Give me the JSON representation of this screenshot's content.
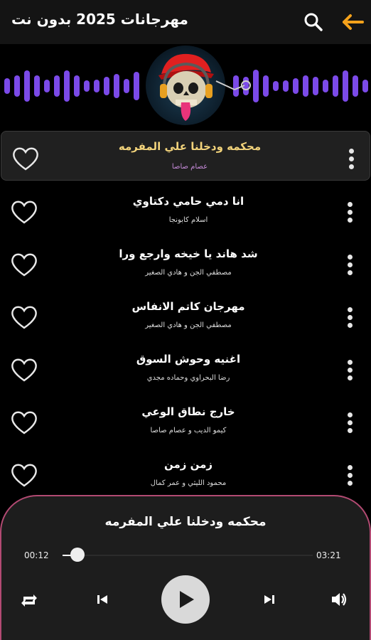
{
  "header": {
    "title": "مهرجانات 2025 بدون نت",
    "back_icon": "back-arrow-icon",
    "search_icon": "search-icon",
    "accent": "#f5a21b"
  },
  "visualizer": {
    "bar_color": "#7b4ae8",
    "cover_icon": "skull-headphones-cover"
  },
  "songs": [
    {
      "title": "محكمه ودخلنا علي المفرمه",
      "artist": "عصام صاصا",
      "active": true
    },
    {
      "title": "انا دمي حامي دكتاوي",
      "artist": "اسلام كابونجا",
      "active": false
    },
    {
      "title": "شد هاند يا خيخه وارجع ورا",
      "artist": "مصطفي الجن و هادي الصغير",
      "active": false
    },
    {
      "title": "مهرجان كاتم الانفاس",
      "artist": "مصطفي الجن و هادي الصغير",
      "active": false
    },
    {
      "title": "اغنيه وحوش السوق",
      "artist": "رضا البحراوي وحماده مجدي",
      "active": false
    },
    {
      "title": "خارج نطاق الوعي",
      "artist": "كيمو الديب و عصام صاصا",
      "active": false
    },
    {
      "title": "زمن زمن",
      "artist": "محمود الليثي و عمر كمال",
      "active": false
    }
  ],
  "player": {
    "now_playing": "محكمه ودخلنا علي المفرمه",
    "current_time": "00:12",
    "total_time": "03:21",
    "progress": 0.06,
    "accent_border": "#b24a72"
  }
}
